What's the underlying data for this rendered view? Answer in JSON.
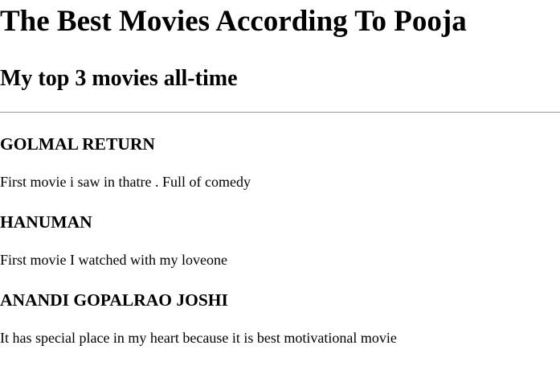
{
  "title": "The Best Movies According To Pooja",
  "subtitle": "My top 3 movies all-time",
  "movies": [
    {
      "name": "GOLMAL RETURN",
      "description": "First movie i saw in thatre . Full of comedy"
    },
    {
      "name": "HANUMAN",
      "description": "First movie I watched with my loveone"
    },
    {
      "name": "ANANDI GOPALRAO JOSHI",
      "description": "It has special place in my heart because it is best motivational movie"
    }
  ]
}
